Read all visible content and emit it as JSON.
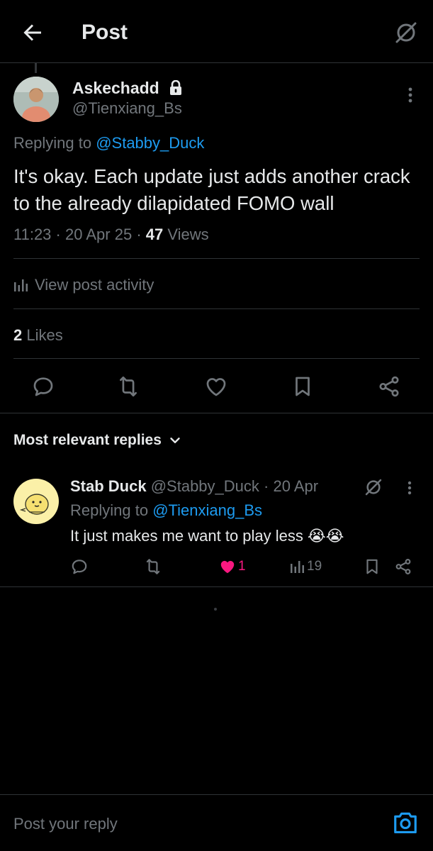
{
  "header": {
    "title": "Post"
  },
  "post": {
    "display_name": "Askechadd",
    "handle": "@Tienxiang_Bs",
    "replying_prefix": "Replying to",
    "replying_handle": "@Stabby_Duck",
    "text": "It's okay. Each update just adds another crack to the already dilapidated FOMO wall",
    "time": "11:23",
    "sep1": "·",
    "date": "20 Apr 25",
    "sep2": "·",
    "views_count": "47",
    "views_label": "Views",
    "activity_label": "View post activity",
    "likes_count": "2",
    "likes_label": "Likes"
  },
  "replies_section": {
    "sort_label": "Most relevant replies"
  },
  "reply": {
    "display_name": "Stab Duck",
    "handle": "@Stabby_Duck",
    "sep": "·",
    "date": "20 Apr",
    "replying_prefix": "Replying to",
    "replying_handle": "@Tienxiang_Bs",
    "text": "It just makes me want to play less 😭😭",
    "likes": "1",
    "views": "19"
  },
  "composer": {
    "placeholder": "Post your reply"
  },
  "colors": {
    "accent": "#1d9bf0",
    "like": "#f91880",
    "muted": "#71767b",
    "border": "#2f3336"
  }
}
